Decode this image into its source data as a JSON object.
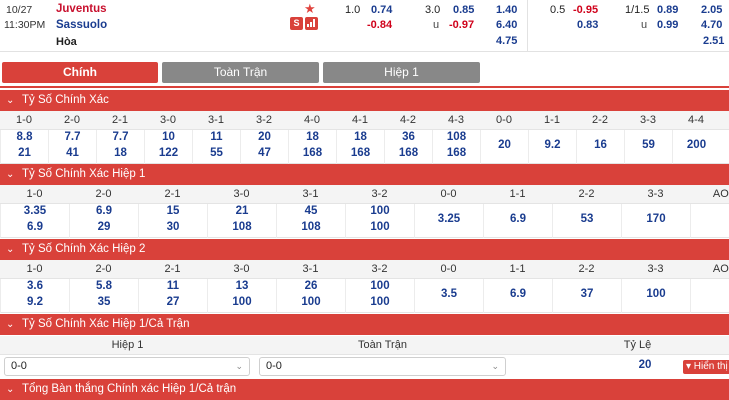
{
  "match": {
    "date": "10/27",
    "time": "11:30PM",
    "home": "Juventus",
    "away": "Sassuolo",
    "draw": "Hòa",
    "hdp_line": "1.0",
    "hdp_home": "0.74",
    "hdp_away": "-0.84",
    "ou_line": "3.0",
    "ou_over": "0.85",
    "ou_u": "u",
    "ou_under": "-0.97",
    "x12_home": "1.40",
    "x12_away": "6.40",
    "x12_draw": "4.75",
    "h1_hdp_line": "0.5",
    "h1_hdp_home": "-0.95",
    "h1_hdp_away": "0.83",
    "h1_ou_line": "1/1.5",
    "h1_ou_over": "0.89",
    "h1_ou_u": "u",
    "h1_ou_under": "0.99",
    "h1_x12_home": "2.05",
    "h1_x12_away": "4.70",
    "h1_x12_draw": "2.51"
  },
  "tabs": {
    "main": "Chính",
    "full": "Toàn Trận",
    "half": "Hiệp 1"
  },
  "sections": {
    "s1": "Tỷ Số Chính Xác",
    "s2": "Tỷ Số Chính Xác Hiệp 1",
    "s3": "Tỷ Số Chính Xác Hiệp 2",
    "s4": "Tỷ Số Chính Xác Hiệp 1/Cả Trận",
    "s5": "Tổng Bàn thắng Chính xác Hiệp 1/Cả trận"
  },
  "grid1": {
    "headers": [
      "1-0",
      "2-0",
      "2-1",
      "3-0",
      "3-1",
      "3-2",
      "4-0",
      "4-1",
      "4-2",
      "4-3",
      "0-0",
      "1-1",
      "2-2",
      "3-3",
      "4-4"
    ],
    "home": [
      "8.8",
      "7.7",
      "7.7",
      "10",
      "11",
      "20",
      "18",
      "18",
      "36",
      "108",
      "20",
      "9.2",
      "16",
      "59",
      "200"
    ],
    "away": [
      "21",
      "41",
      "18",
      "122",
      "55",
      "47",
      "168",
      "168",
      "168",
      "168",
      "",
      "",
      "",
      "",
      ""
    ]
  },
  "grid2": {
    "headers": [
      "1-0",
      "2-0",
      "2-1",
      "3-0",
      "3-1",
      "3-2",
      "0-0",
      "1-1",
      "2-2",
      "3-3",
      "AOS"
    ],
    "home": [
      "3.35",
      "6.9",
      "15",
      "21",
      "45",
      "100",
      "3.25",
      "6.9",
      "53",
      "170",
      ""
    ],
    "away": [
      "6.9",
      "29",
      "30",
      "108",
      "108",
      "100",
      "",
      "",
      "",
      "",
      ""
    ]
  },
  "grid3": {
    "headers": [
      "1-0",
      "2-0",
      "2-1",
      "3-0",
      "3-1",
      "3-2",
      "0-0",
      "1-1",
      "2-2",
      "3-3",
      "AOS"
    ],
    "home": [
      "3.6",
      "5.8",
      "11",
      "13",
      "26",
      "100",
      "3.5",
      "6.9",
      "37",
      "100",
      ""
    ],
    "away": [
      "9.2",
      "35",
      "27",
      "100",
      "100",
      "100",
      "",
      "",
      "",
      "",
      ""
    ]
  },
  "selector": {
    "col1": "Hiệp 1",
    "col2": "Toàn Trận",
    "col3": "Tỷ Lệ",
    "sel1_value": "0-0",
    "sel2_value": "0-0",
    "odd": "20",
    "show_label": "▾ Hiển thị"
  }
}
